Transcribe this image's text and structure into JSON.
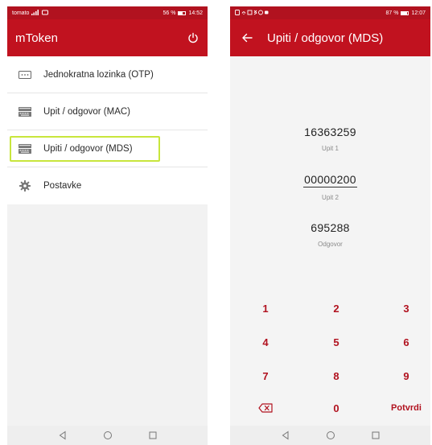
{
  "left": {
    "status": {
      "carrier": "tomato",
      "battery_text": "56 %",
      "battery_level": 0.56,
      "time": "14:52"
    },
    "app_title": "mToken",
    "menu_items": [
      {
        "label": "Jednokratna lozinka (OTP)",
        "icon": "password-dots-icon"
      },
      {
        "label": "Upit / odgovor (MAC)",
        "icon": "keyboard-icon"
      },
      {
        "label": "Upiti / odgovor (MDS)",
        "icon": "keyboard-icon",
        "highlighted": true
      },
      {
        "label": "Postavke",
        "icon": "gear-icon"
      }
    ]
  },
  "right": {
    "status": {
      "battery_text": "87 %",
      "battery_level": 0.87,
      "time": "12:07"
    },
    "app_title": "Upiti / odgovor (MDS)",
    "fields": [
      {
        "value": "16363259",
        "label": "Upit 1"
      },
      {
        "value": "00000200",
        "label": "Upit 2",
        "active": true
      },
      {
        "value": "695288",
        "label": "Odgovor"
      }
    ],
    "keypad": {
      "keys": [
        "1",
        "2",
        "3",
        "4",
        "5",
        "6",
        "7",
        "8",
        "9",
        "",
        "0",
        "Potvrdi"
      ]
    }
  },
  "colors": {
    "brand_red": "#c1121f",
    "status_red": "#b1121f",
    "highlight": "#c8e63c"
  }
}
